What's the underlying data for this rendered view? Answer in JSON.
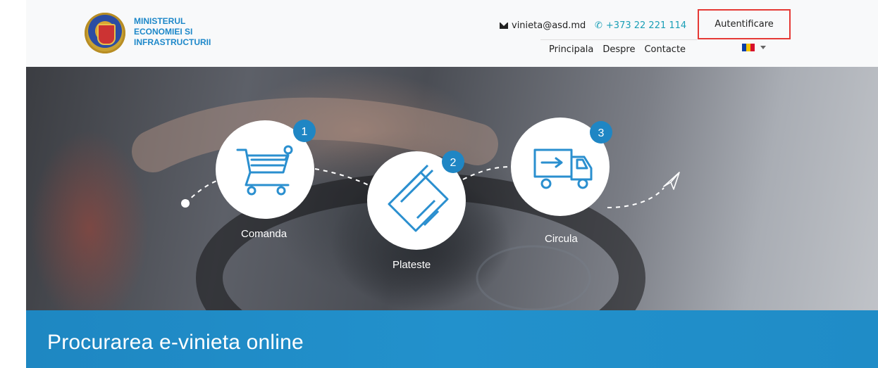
{
  "header": {
    "ministry_lines": [
      "MINISTERUL",
      "ECONOMIEI SI",
      "INFRASTRUCTURII"
    ],
    "email": "vinieta@asd.md",
    "phone": "+373 22 221 114",
    "login_label": "Autentificare",
    "nav": [
      "Principala",
      "Despre",
      "Contacte"
    ],
    "language_flag_colors": [
      "#0a3ea6",
      "#f5c400",
      "#d7102c"
    ]
  },
  "steps": [
    {
      "number": "1",
      "label": "Comanda",
      "icon": "shopping-cart-icon"
    },
    {
      "number": "2",
      "label": "Plateste",
      "icon": "credit-card-icon"
    },
    {
      "number": "3",
      "label": "Circula",
      "icon": "delivery-truck-icon"
    }
  ],
  "banner": {
    "title": "Procurarea e-vinieta online"
  },
  "colors": {
    "accent": "#1e88c9",
    "badge": "#1f86c4",
    "login_border": "#e53935",
    "icon_blue": "#2a8fcf"
  }
}
